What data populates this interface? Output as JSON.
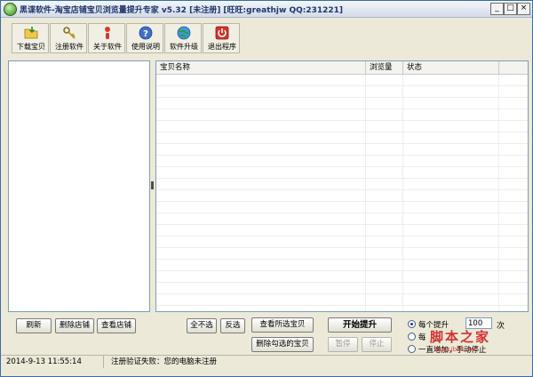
{
  "window": {
    "title": "黑谍软件-淘宝店铺宝贝浏览量提升专家 v5.32 [未注册] [旺旺:greathjw QQ:231221]",
    "controls": [
      "_",
      "□",
      "×"
    ]
  },
  "toolbar": [
    {
      "label": "下载宝贝",
      "icon": "folder-download-icon"
    },
    {
      "label": "注册软件",
      "icon": "keys-icon"
    },
    {
      "label": "关于软件",
      "icon": "info-person-icon"
    },
    {
      "label": "使用说明",
      "icon": "help-icon"
    },
    {
      "label": "软件升级",
      "icon": "globe-update-icon"
    },
    {
      "label": "退出程序",
      "icon": "power-exit-icon"
    }
  ],
  "table": {
    "columns": [
      "宝贝名称",
      "浏览量",
      "状态"
    ],
    "row_count": 22
  },
  "buttons": {
    "refresh": "刷新",
    "delete_shop": "删除店铺",
    "view_shop": "查看店铺",
    "select_none": "全不选",
    "invert": "反选",
    "view_selected": "查看所选宝贝",
    "delete_checked": "删除勾选的宝贝",
    "start": "开始提升",
    "pause": "暂停",
    "stop": "停止"
  },
  "options": {
    "per_item": "每个提升",
    "per_item_value": "100",
    "unit": "次",
    "second_option": "每",
    "continuous": "一直增加，手动停止"
  },
  "status": {
    "timestamp": "2014-9-13 11:55:14",
    "message": "注册验证失败：您的电脑未注册"
  },
  "watermark": {
    "text": "脚本之家",
    "sub": "www.jb51.net"
  },
  "colors": {
    "accent": "#3a6ea5",
    "face": "#ece9d8",
    "watermark": "#d4312f"
  }
}
